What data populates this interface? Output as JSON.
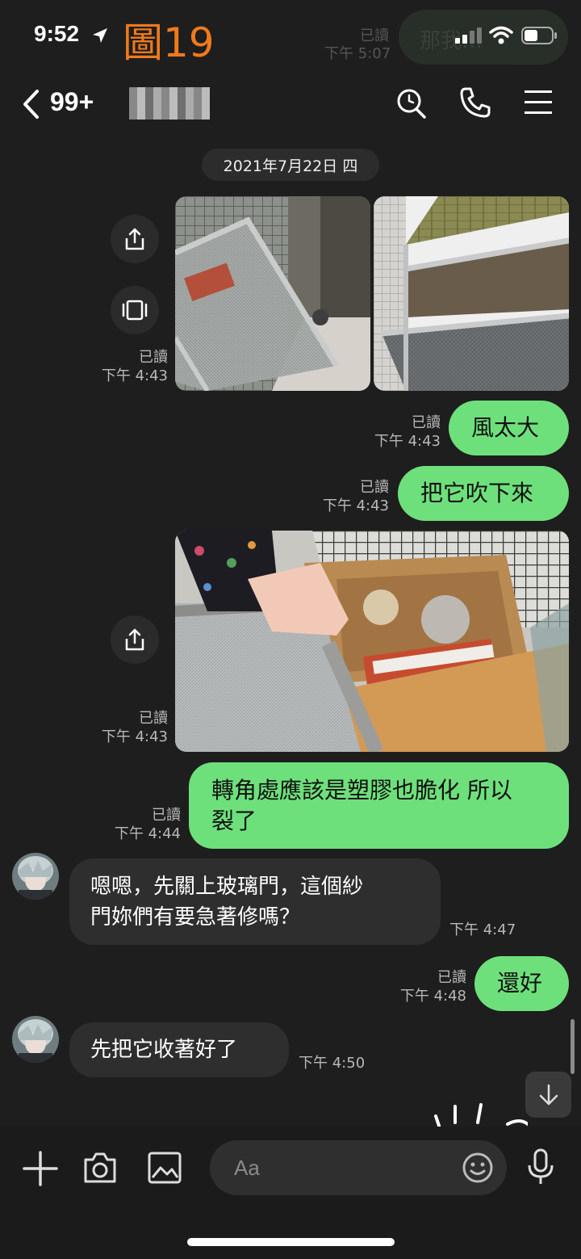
{
  "status": {
    "time": "9:52",
    "figure_label": "圖19"
  },
  "ghost": {
    "bubble": "那我…",
    "time": "下午 5:07",
    "read": "已讀"
  },
  "header": {
    "unread_count": "99+"
  },
  "date_chip": "2021年7月22日 四",
  "messages": {
    "img1": {
      "read": "已讀",
      "time": "下午 4:43"
    },
    "m1": {
      "text": "風太大",
      "read": "已讀",
      "time": "下午 4:43"
    },
    "m2": {
      "text": "把它吹下來",
      "read": "已讀",
      "time": "下午 4:43"
    },
    "img2": {
      "read": "已讀",
      "time": "下午 4:43"
    },
    "m3": {
      "line1": "轉角處應該是塑膠也脆化 所以",
      "line2": "裂了",
      "read": "已讀",
      "time": "下午 4:44"
    },
    "r1": {
      "line1": "嗯嗯，先關上玻璃門，這個紗",
      "line2": "門妳們有要急著修嗎？",
      "time": "下午 4:47"
    },
    "m4": {
      "text": "還好",
      "read": "已讀",
      "time": "下午 4:48"
    },
    "r2": {
      "text": "先把它收著好了",
      "time": "下午 4:50"
    }
  },
  "composer": {
    "placeholder": "Aa"
  },
  "colors": {
    "accent_green": "#6ee07b",
    "figure_label": "#f07a1c",
    "background": "#1e1e1e"
  }
}
